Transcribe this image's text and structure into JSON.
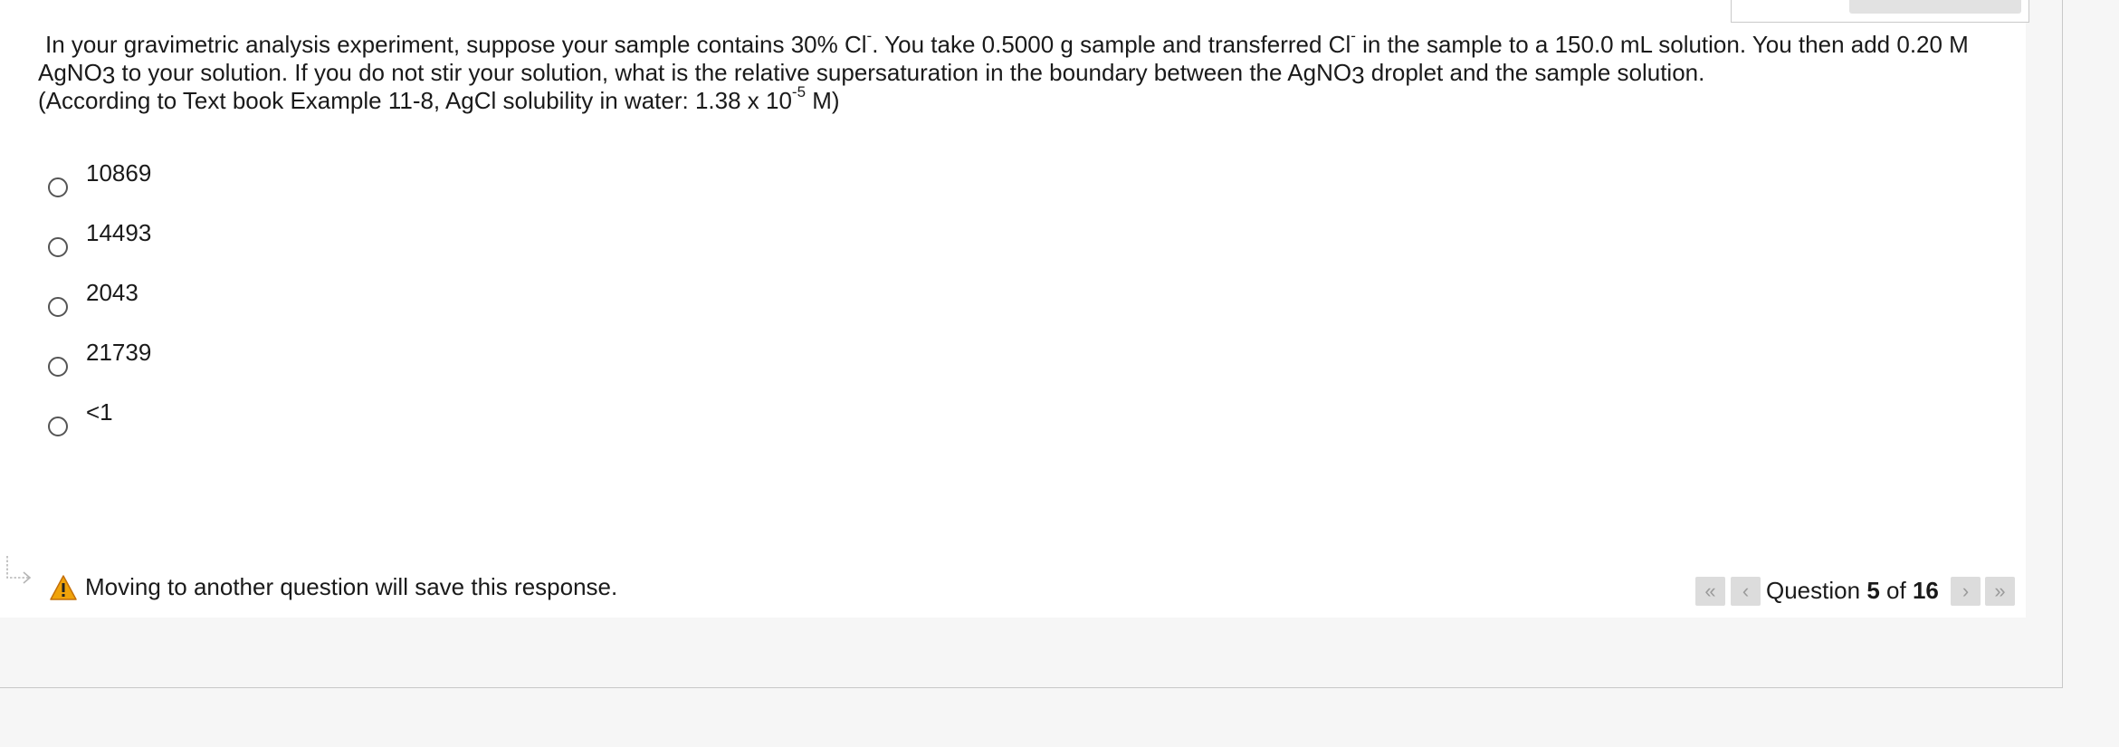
{
  "question": {
    "line1_a": "In your gravimetric analysis experiment, suppose your sample contains 30% Cl",
    "cl_sup": "-",
    "line1_b": ".  You take 0.5000 g sample and transferred Cl",
    "line1_c": " in the sample to a 150.0 mL solution.  You then add 0.20 M AgNO",
    "sub3": "3",
    "line1_d": " to your solution. If you do not stir your solution, what is the relative supersaturation in the boundary between the AgNO",
    "line1_e": " droplet and the sample solution.",
    "note_a": "(According to Text book Example 11-8, AgCl solubility in water: 1.38 x 10",
    "note_exp": "-5",
    "note_b": " M)"
  },
  "options": [
    {
      "label": "10869",
      "selected": false
    },
    {
      "label": "14493",
      "selected": false
    },
    {
      "label": "2043",
      "selected": false
    },
    {
      "label": "21739",
      "selected": false
    },
    {
      "label": "<1",
      "selected": false
    }
  ],
  "footer": {
    "warning": "Moving to another question will save this response."
  },
  "navigation": {
    "first_icon": "double-chevron-left-icon",
    "prev_icon": "chevron-left-icon",
    "next_icon": "chevron-right-icon",
    "last_icon": "double-chevron-right-icon",
    "prefix": "Question",
    "current": "5",
    "of": "of",
    "total": "16"
  },
  "colors": {
    "warning": "#f0a30a",
    "nav_button_bg": "#dcdcdc"
  }
}
